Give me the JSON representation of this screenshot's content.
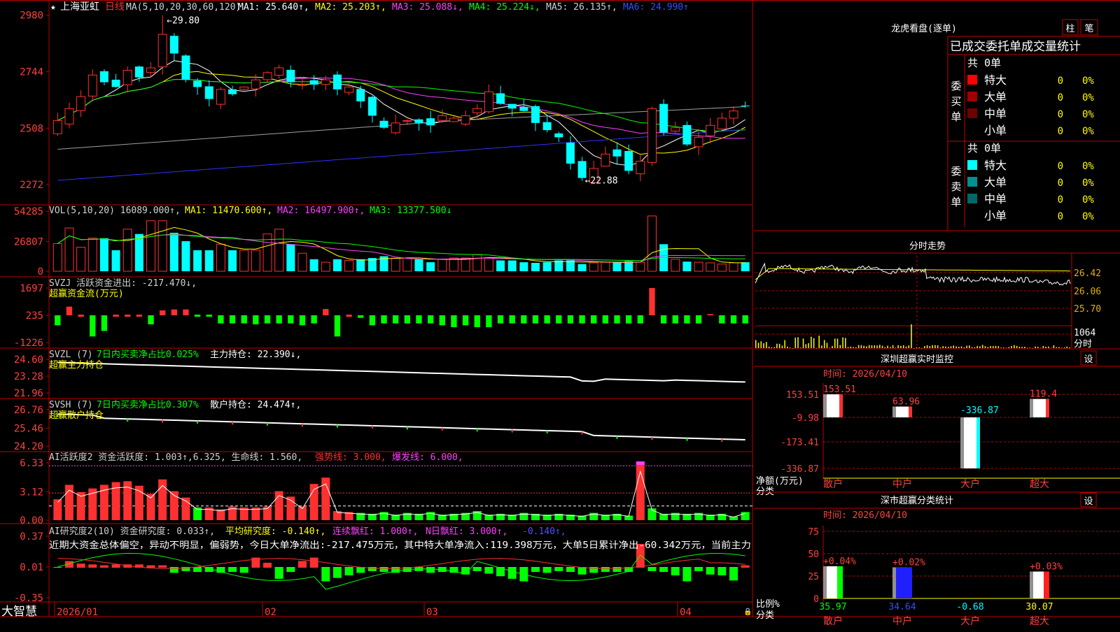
{
  "colors": {
    "up": "#ff3030",
    "down": "#00ffff",
    "ma_white": "#ffffff",
    "ma_yellow": "#ffff00",
    "ma_magenta": "#ff40ff",
    "ma_green": "#00ff00",
    "ma_gray": "#a0a0a0",
    "ma_blue": "#3030ff",
    "grid": "#c00000",
    "label_red": "#ff4040",
    "gold": "#e0b000"
  },
  "main": {
    "star": "★",
    "stock_name": "上海亚虹",
    "period": "日线",
    "ma_title": "MA(5,10,20,30,60,120)",
    "ma_items": [
      {
        "text": "MA1: 25.640↑,",
        "color": "#ffffff"
      },
      {
        "text": "MA2: 25.203↑,",
        "color": "#ffff00"
      },
      {
        "text": "MA3: 25.088↓,",
        "color": "#ff40ff"
      },
      {
        "text": "MA4: 25.224↓,",
        "color": "#00ff00"
      },
      {
        "text": "MA5: 26.135↑,",
        "color": "#d0d0d0"
      },
      {
        "text": "MA6: 24.990↑",
        "color": "#3050ff"
      }
    ],
    "yticks": [
      "2980",
      "2744",
      "2508",
      "2272"
    ],
    "high_label": "←29.80",
    "low_label": "←22.88"
  },
  "vol": {
    "title": "VOL(5,10,20) 16089.000↑,",
    "items": [
      {
        "text": "MA1: 11470.600↑,",
        "color": "#ffff00"
      },
      {
        "text": "MA2: 16497.900↑,",
        "color": "#ff40ff"
      },
      {
        "text": "MA3: 13377.500↓",
        "color": "#00ff00"
      }
    ],
    "yticks": [
      "54285",
      "26807",
      "0"
    ]
  },
  "svzj": {
    "title": "SVZJ  活跃资金进出: -217.470↓,",
    "subtitle": "超赢资金流(万元)",
    "yticks": [
      "1697",
      "235",
      "-1226"
    ]
  },
  "svzl": {
    "title": "SVZL (7)",
    "pct": "7日内买卖净占比0.025%",
    "hold": "主力持仓: 22.390↓,",
    "subtitle": "超赢主力持仓",
    "yticks": [
      "24.60",
      "23.28",
      "21.96"
    ]
  },
  "svsh": {
    "title": "SVSH (7)",
    "pct": "7日内买卖净占比0.307%",
    "hold": "散户持仓: 24.474↑,",
    "subtitle": "超赢散户持仓",
    "yticks": [
      "26.76",
      "25.46",
      "24.20"
    ]
  },
  "ai1": {
    "title": "AI活跃度2 资金活跃度: 1.003↑,6.325, 生命线: 1.560,",
    "strong": "强势线: 3.000,",
    "burst": "爆发线: 6.000,",
    "yticks": [
      "6.33",
      "3.12",
      "0.00"
    ]
  },
  "ai2": {
    "title": "AI研究度2(10) 资金研究度: 0.033↑,",
    "avg": "平均研究度: -0.140↑,",
    "cont": "连续飘红: 1.000↑,",
    "nday": "N日飘红: 3.000↑,",
    "last": "-0.140↑,",
    "comment": "近期大资金总体偏空，异动不明显，偏弱势，今日大单净流出:-217.475万元，其中特大单净流入:119.398万元，大单5日累计净出-60.342万元，当前主力",
    "yticks": [
      "0.37",
      "0.01",
      "-0.35"
    ]
  },
  "xaxis": {
    "logo": "大智慧",
    "labels": [
      "2026/01",
      "02",
      "03",
      "04"
    ]
  },
  "longhu": {
    "title": "龙虎看盘(逐单)",
    "btn_bar": "柱",
    "btn_pen": "笔",
    "header": "已成交委托单成交量统计",
    "buy": {
      "side": "委买单",
      "total": "共 0单",
      "rows": [
        {
          "name": "特大",
          "num": "0",
          "pct": "0%",
          "color": "#ff0000"
        },
        {
          "name": "大单",
          "num": "0",
          "pct": "0%",
          "color": "#a00000"
        },
        {
          "name": "中单",
          "num": "0",
          "pct": "0%",
          "color": "#700000"
        },
        {
          "name": "小单",
          "num": "0",
          "pct": "0%",
          "color": "#000000"
        }
      ]
    },
    "sell": {
      "side": "委卖单",
      "total": "共 0单",
      "rows": [
        {
          "name": "特大",
          "num": "0",
          "pct": "0%",
          "color": "#00ffff"
        },
        {
          "name": "大单",
          "num": "0",
          "pct": "0%",
          "color": "#009090"
        },
        {
          "name": "中单",
          "num": "0",
          "pct": "0%",
          "color": "#006868"
        },
        {
          "name": "小单",
          "num": "0",
          "pct": "0%",
          "color": "#000000"
        }
      ]
    }
  },
  "minute": {
    "title": "分时走势",
    "yticks": [
      "26.42",
      "26.06",
      "25.70"
    ],
    "vol_label": "1064",
    "vol_unit": "分时"
  },
  "szmon": {
    "title": "深圳超赢实时监控",
    "set": "设",
    "time": "时间: 2026/04/10",
    "yticks": [
      "153.51",
      "-9.98",
      "-173.41",
      "-336.87"
    ],
    "ylabel": "净额(万元)",
    "xlabel": "分类",
    "bars": [
      {
        "cat": "散户",
        "value": 153.51,
        "label": "153.51"
      },
      {
        "cat": "中户",
        "value": 63.96,
        "label": "63.96"
      },
      {
        "cat": "大户",
        "value": -336.87,
        "label": "-336.87"
      },
      {
        "cat": "超大",
        "value": 119.4,
        "label": "119.4"
      }
    ]
  },
  "szcls": {
    "title": "深市超赢分类统计",
    "set": "设",
    "time": "时间: 2026/04/10",
    "yticks": [
      "75",
      "50",
      "25",
      "0"
    ],
    "ylabel": "比例%",
    "xlabel": "分类",
    "bars": [
      {
        "cat": "散户",
        "value": 35.97,
        "top": "+0.04%",
        "bottom": "35.97",
        "color": "#00ff00",
        "bcolor": "#00ff00"
      },
      {
        "cat": "中户",
        "value": 34.64,
        "top": "+0.02%",
        "bottom": "34.64",
        "color": "#2020ff",
        "bcolor": "#3050ff"
      },
      {
        "cat": "大户",
        "value": 0,
        "top": "",
        "bottom": "-0.68",
        "color": "#00ffff",
        "bcolor": "#00ffff"
      },
      {
        "cat": "超大",
        "value": 30.07,
        "top": "+0.03%",
        "bottom": "30.07",
        "color": "#ff2020",
        "bcolor": "#ffff00"
      }
    ]
  }
}
